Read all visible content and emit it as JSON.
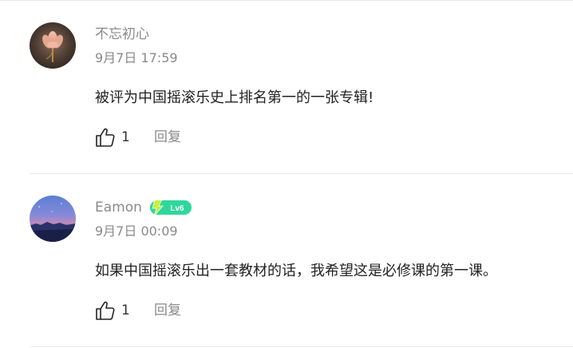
{
  "comments": [
    {
      "username": "不忘初心",
      "has_level_badge": false,
      "avatar_icon": "lotus-flower-avatar",
      "timestamp": "9月7日 17:59",
      "text": "被评为中国摇滚乐史上排名第一的一张专辑!",
      "likes": "1",
      "reply_label": "回复"
    },
    {
      "username": "Eamon",
      "has_level_badge": true,
      "level_badge": "Lv6",
      "avatar_icon": "night-landscape-avatar",
      "timestamp": "9月7日 00:09",
      "text": "如果中国摇滚乐出一套教材的话，我希望这是必修课的第一课。",
      "likes": "1",
      "reply_label": "回复"
    }
  ],
  "colors": {
    "meta_text": "#8a8a8a",
    "body_text": "#222222",
    "divider": "#e8e8e8",
    "badge_green": "#2fd79a",
    "badge_bolt": "#c8f23a"
  },
  "icons": {
    "like": "thumbs-up-outline-icon",
    "badge": "lightning-bolt-icon"
  }
}
